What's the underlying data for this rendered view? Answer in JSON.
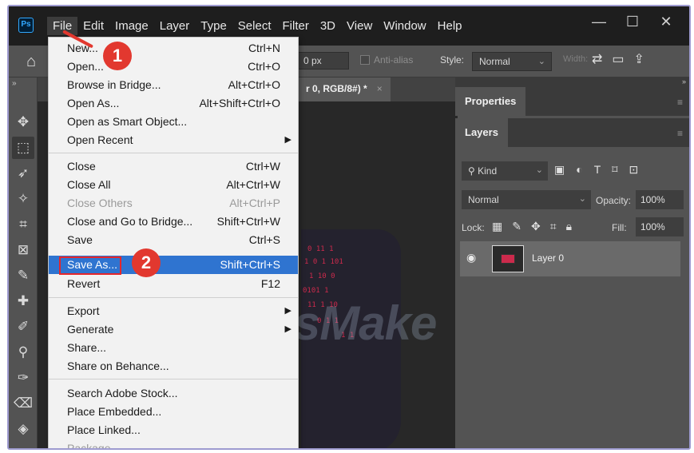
{
  "app": {
    "logo_text": "Ps",
    "menu": [
      "File",
      "Edit",
      "Image",
      "Layer",
      "Type",
      "Select",
      "Filter",
      "3D",
      "View",
      "Window",
      "Help"
    ],
    "window_controls": [
      "—",
      "☐",
      "✕"
    ]
  },
  "options_bar": {
    "feather_value": "0 px",
    "antialias_label": "Anti-alias",
    "style_label": "Style:",
    "style_value": "Normal",
    "width_label": "Width:"
  },
  "document": {
    "tab_title": "r 0, RGB/8#) *",
    "tab_close": "×"
  },
  "watermark": "TipsMake",
  "panels": {
    "properties_tab": "Properties",
    "layers_tab": "Layers",
    "kind_label": "Kind",
    "blend_mode": "Normal",
    "opacity_label": "Opacity:",
    "opacity_value": "100%",
    "lock_label": "Lock:",
    "fill_label": "Fill:",
    "fill_value": "100%",
    "layer_name": "Layer 0"
  },
  "file_menu": {
    "items": [
      {
        "label": "New...",
        "shortcut": "Ctrl+N"
      },
      {
        "label": "Open...",
        "shortcut": "Ctrl+O"
      },
      {
        "label": "Browse in Bridge...",
        "shortcut": "Alt+Ctrl+O"
      },
      {
        "label": "Open As...",
        "shortcut": "Alt+Shift+Ctrl+O"
      },
      {
        "label": "Open as Smart Object...",
        "shortcut": ""
      },
      {
        "label": "Open Recent",
        "shortcut": ""
      },
      {
        "label": "Close",
        "shortcut": "Ctrl+W"
      },
      {
        "label": "Close All",
        "shortcut": "Alt+Ctrl+W"
      },
      {
        "label": "Close Others",
        "shortcut": "Alt+Ctrl+P"
      },
      {
        "label": "Close and Go to Bridge...",
        "shortcut": "Shift+Ctrl+W"
      },
      {
        "label": "Save",
        "shortcut": "Ctrl+S"
      },
      {
        "label": "Save As...",
        "shortcut": "Shift+Ctrl+S"
      },
      {
        "label": "Revert",
        "shortcut": "F12"
      },
      {
        "label": "Export",
        "shortcut": ""
      },
      {
        "label": "Generate",
        "shortcut": ""
      },
      {
        "label": "Share...",
        "shortcut": ""
      },
      {
        "label": "Share on Behance...",
        "shortcut": ""
      },
      {
        "label": "Search Adobe Stock...",
        "shortcut": ""
      },
      {
        "label": "Place Embedded...",
        "shortcut": ""
      },
      {
        "label": "Place Linked...",
        "shortcut": ""
      },
      {
        "label": "Package...",
        "shortcut": ""
      }
    ]
  },
  "annotations": {
    "step1": "1",
    "step2": "2",
    "accent_color": "#e2382f",
    "highlight_color": "#2f74d0"
  }
}
